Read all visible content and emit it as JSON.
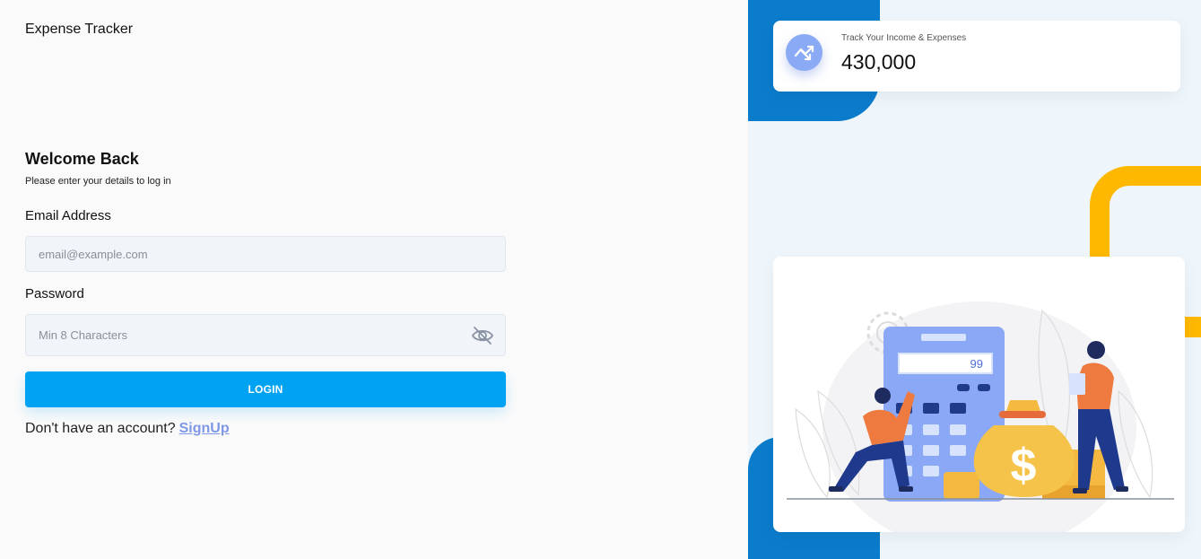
{
  "app": {
    "title": "Expense Tracker"
  },
  "login": {
    "heading": "Welcome Back",
    "subheading": "Please enter your details to log in",
    "email_label": "Email Address",
    "email_placeholder": "email@example.com",
    "password_label": "Password",
    "password_placeholder": "Min 8 Characters",
    "login_button": "LOGIN",
    "signup_prompt": "Don't have an account?",
    "signup_link": "SignUp"
  },
  "stats": {
    "label": "Track Your Income & Expenses",
    "value": "430,000",
    "icon": "trending-up-icon"
  },
  "illustration": {
    "calculator_display": "99",
    "dollar_sign": "$"
  },
  "colors": {
    "primary": "#00a3f2",
    "link": "#7e97e6",
    "blue_blob": "#0b7ccc",
    "yellow_accent": "#ffb800",
    "icon_bg": "#8aaaf5"
  }
}
